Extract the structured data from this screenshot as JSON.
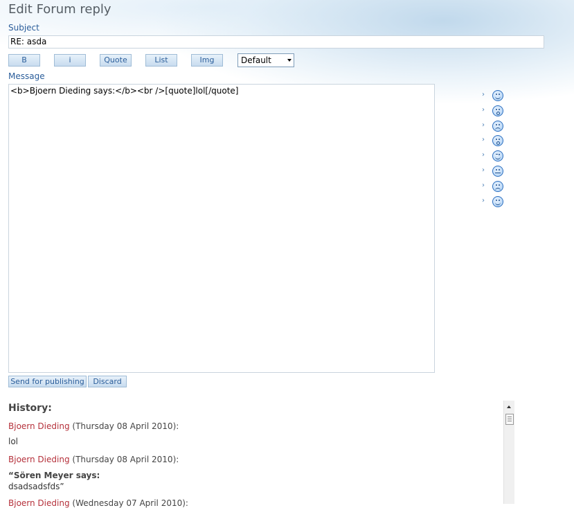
{
  "page": {
    "title": "Edit Forum reply"
  },
  "subject": {
    "label": "Subject",
    "value": "RE: asda"
  },
  "toolbar": {
    "buttons": [
      "B",
      "i",
      "Quote",
      "List",
      "Img"
    ],
    "select_value": "Default"
  },
  "message": {
    "label": "Message",
    "value": "<b>Bjoern Dieding says:</b><br />[quote]lol[/quote]"
  },
  "smileys": [
    "smile",
    "surprised",
    "sad",
    "shocked",
    "wink",
    "neutral",
    "frown",
    "happy"
  ],
  "actions": {
    "publish_label": "Send for publishing",
    "discard_label": "Discard"
  },
  "history": {
    "title": "History:",
    "entries": [
      {
        "author": "Bjoern Dieding",
        "date": "(Thursday 08 April 2010):",
        "body": "lol"
      },
      {
        "author": "Bjoern Dieding",
        "date": "(Thursday 08 April 2010):",
        "quote_author": "“Sören Meyer says:",
        "body": "dsadsadsfds”"
      },
      {
        "author": "Bjoern Dieding",
        "date": "(Wednesday 07 April 2010):"
      }
    ]
  },
  "colors": {
    "label": "#2a5d9a",
    "author": "#b5313b",
    "button_border": "#9fbcd6"
  }
}
